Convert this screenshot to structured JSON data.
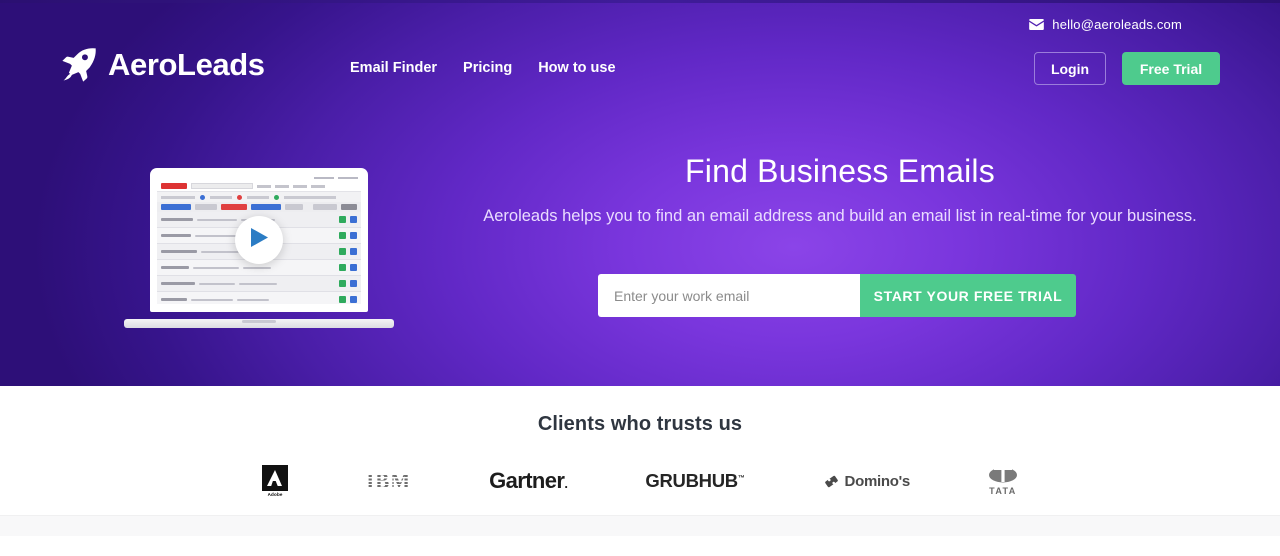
{
  "header": {
    "email": "hello@aeroleads.com",
    "email_icon": "envelope-icon",
    "logo_text": "AeroLeads",
    "logo_icon": "rocket-icon",
    "nav": [
      {
        "label": "Email Finder"
      },
      {
        "label": "Pricing"
      },
      {
        "label": "How to use"
      }
    ],
    "login_label": "Login",
    "free_trial_label": "Free Trial"
  },
  "hero": {
    "heading": "Find Business Emails",
    "subheading": "Aeroleads helps you to find an email address and build an email list in real-time for your business.",
    "email_placeholder": "Enter your work email",
    "email_value": "",
    "cta_label": "START YOUR FREE TRIAL",
    "play_icon": "play-icon",
    "video_thumbnail_alt": "AeroLeads app dashboard on laptop"
  },
  "clients": {
    "title": "Clients who trusts us",
    "logos": [
      {
        "name": "Adobe",
        "sub": "Adobe"
      },
      {
        "name": "IBM"
      },
      {
        "name": "Gartner"
      },
      {
        "name": "GRUBHUB"
      },
      {
        "name": "Domino's"
      },
      {
        "name": "TATA"
      }
    ]
  },
  "colors": {
    "hero_gradient_center": "#8b44e8",
    "hero_gradient_edge": "#2d0f78",
    "accent_green": "#4ecb8d",
    "login_border": "#9b7ddb",
    "play_blue": "#2b7cc4",
    "clients_title": "#2f3640"
  }
}
